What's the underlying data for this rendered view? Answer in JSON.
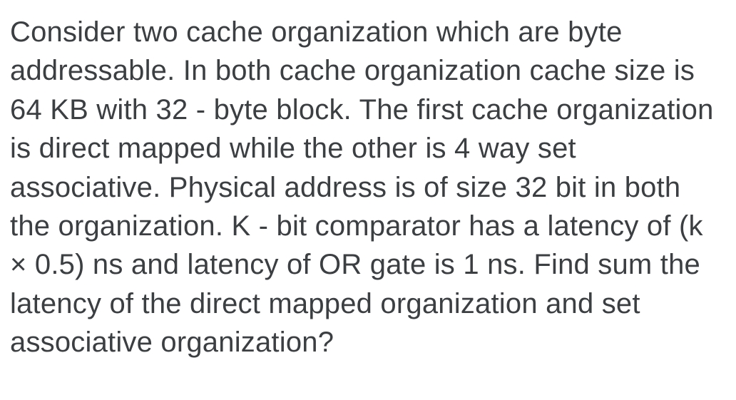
{
  "passage": {
    "text": "Consider two cache organization which are byte addressable. In both cache organization cache size is 64 KB with 32 - byte block. The first cache organization is direct mapped while the other is 4 way set associative. Physical address is of size 32 bit in both the organization. K - bit comparator has a latency of (k × 0.5) ns and latency of OR gate is 1 ns. Find sum the latency of the direct mapped organization and set associative organization?"
  }
}
